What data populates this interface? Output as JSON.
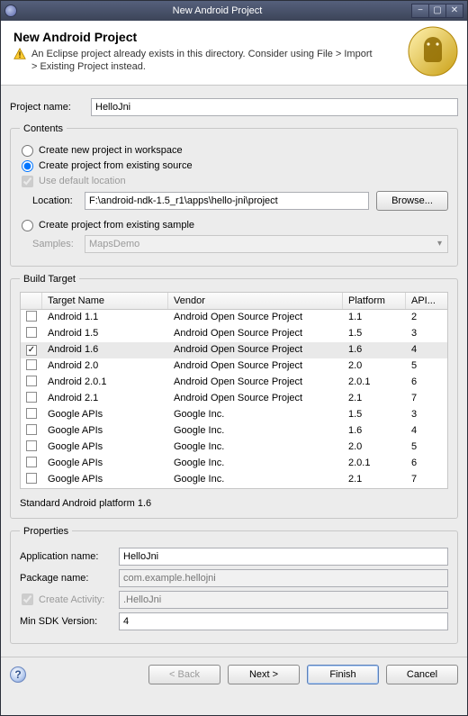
{
  "window": {
    "title": "New Android Project"
  },
  "banner": {
    "heading": "New Android Project",
    "warning": "An Eclipse project already exists in this directory. Consider using File > Import > Existing Project instead."
  },
  "projectName": {
    "label": "Project name:",
    "value": "HelloJni"
  },
  "contents": {
    "legend": "Contents",
    "optWorkspace": "Create new project in workspace",
    "optExisting": "Create project from existing source",
    "selected": "existing",
    "useDefault": "Use default location",
    "useDefaultChecked": true,
    "locationLabel": "Location:",
    "locationValue": "F:\\android-ndk-1.5_r1\\apps\\hello-jni\\project",
    "browse": "Browse...",
    "optSample": "Create project from existing sample",
    "samplesLabel": "Samples:",
    "samplesValue": "MapsDemo"
  },
  "buildTarget": {
    "legend": "Build Target",
    "columns": {
      "name": "Target Name",
      "vendor": "Vendor",
      "platform": "Platform",
      "api": "API..."
    },
    "rows": [
      {
        "checked": false,
        "name": "Android 1.1",
        "vendor": "Android Open Source Project",
        "platform": "1.1",
        "api": "2"
      },
      {
        "checked": false,
        "name": "Android 1.5",
        "vendor": "Android Open Source Project",
        "platform": "1.5",
        "api": "3"
      },
      {
        "checked": true,
        "name": "Android 1.6",
        "vendor": "Android Open Source Project",
        "platform": "1.6",
        "api": "4"
      },
      {
        "checked": false,
        "name": "Android 2.0",
        "vendor": "Android Open Source Project",
        "platform": "2.0",
        "api": "5"
      },
      {
        "checked": false,
        "name": "Android 2.0.1",
        "vendor": "Android Open Source Project",
        "platform": "2.0.1",
        "api": "6"
      },
      {
        "checked": false,
        "name": "Android 2.1",
        "vendor": "Android Open Source Project",
        "platform": "2.1",
        "api": "7"
      },
      {
        "checked": false,
        "name": "Google APIs",
        "vendor": "Google Inc.",
        "platform": "1.5",
        "api": "3"
      },
      {
        "checked": false,
        "name": "Google APIs",
        "vendor": "Google Inc.",
        "platform": "1.6",
        "api": "4"
      },
      {
        "checked": false,
        "name": "Google APIs",
        "vendor": "Google Inc.",
        "platform": "2.0",
        "api": "5"
      },
      {
        "checked": false,
        "name": "Google APIs",
        "vendor": "Google Inc.",
        "platform": "2.0.1",
        "api": "6"
      },
      {
        "checked": false,
        "name": "Google APIs",
        "vendor": "Google Inc.",
        "platform": "2.1",
        "api": "7"
      }
    ],
    "summary": "Standard Android platform 1.6"
  },
  "properties": {
    "legend": "Properties",
    "appNameLabel": "Application name:",
    "appNameValue": "HelloJni",
    "pkgLabel": "Package name:",
    "pkgPlaceholder": "com.example.hellojni",
    "createActivityLabel": "Create Activity:",
    "createActivityChecked": true,
    "activityPlaceholder": ".HelloJni",
    "minSdkLabel": "Min SDK Version:",
    "minSdkValue": "4"
  },
  "footer": {
    "help": "?",
    "back": "< Back",
    "next": "Next >",
    "finish": "Finish",
    "cancel": "Cancel"
  }
}
